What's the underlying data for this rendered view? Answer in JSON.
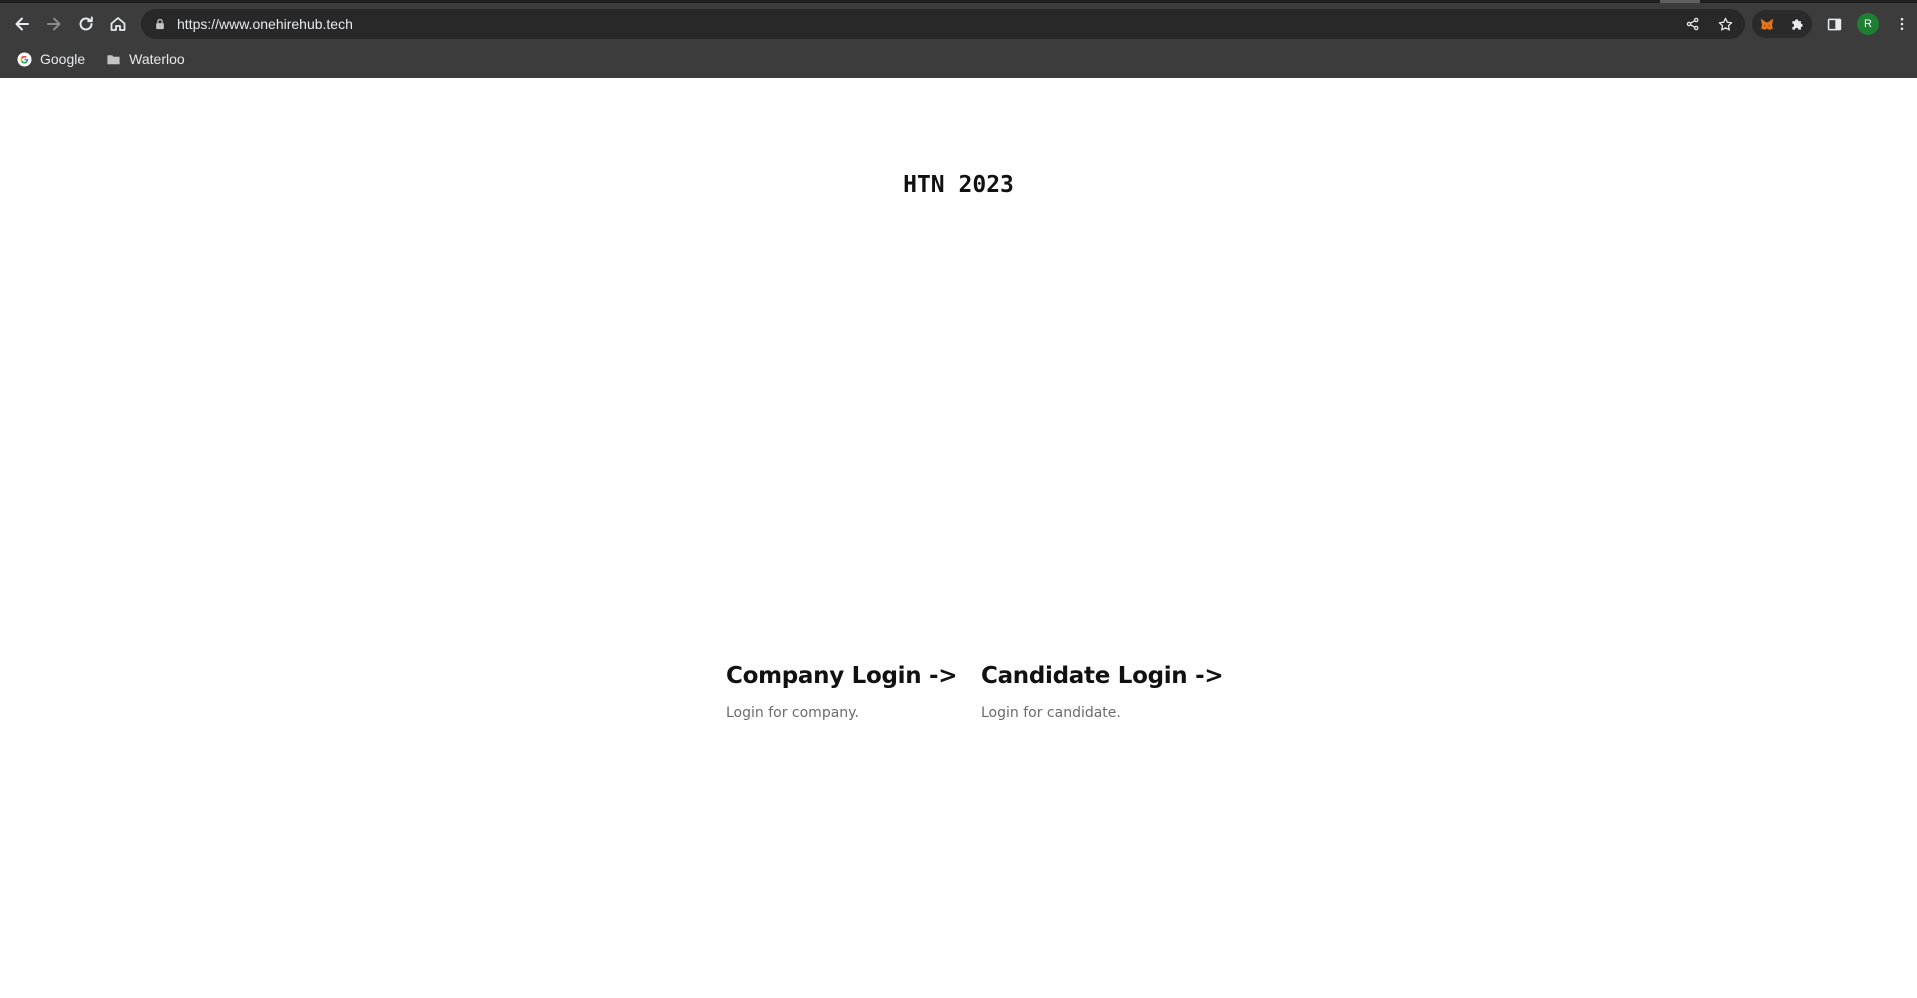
{
  "browser": {
    "url": "https://www.onehirehub.tech",
    "bookmarks": [
      {
        "label": "Google",
        "icon": "google-icon"
      },
      {
        "label": "Waterloo",
        "icon": "folder-icon"
      }
    ],
    "profile_initial": "R",
    "colors": {
      "chrome_bg": "#3c3c3c",
      "omnibox_bg": "#282828",
      "text": "#e8eaed",
      "avatar": "#1e7e34"
    }
  },
  "page": {
    "title": "HTN 2023",
    "cards": [
      {
        "heading": "Company Login ->",
        "description": "Login for company."
      },
      {
        "heading": "Candidate Login ->",
        "description": "Login for candidate."
      }
    ]
  }
}
